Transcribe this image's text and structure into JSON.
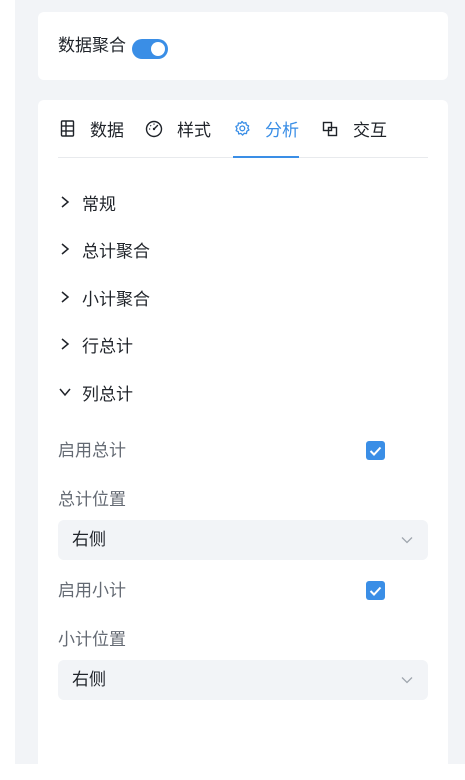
{
  "aggregation": {
    "label": "数据聚合",
    "enabled": true
  },
  "tabs": [
    {
      "label": "数据",
      "icon": "data-table-icon",
      "active": false
    },
    {
      "label": "样式",
      "icon": "style-gauge-icon",
      "active": false
    },
    {
      "label": "分析",
      "icon": "settings-gear-icon",
      "active": true
    },
    {
      "label": "交互",
      "icon": "interaction-icon",
      "active": false
    }
  ],
  "sections": [
    {
      "label": "常规",
      "expanded": false
    },
    {
      "label": "总计聚合",
      "expanded": false
    },
    {
      "label": "小计聚合",
      "expanded": false
    },
    {
      "label": "行总计",
      "expanded": false
    },
    {
      "label": "列总计",
      "expanded": true
    }
  ],
  "column_total": {
    "enable_total_label": "启用总计",
    "enable_total_checked": true,
    "total_position_label": "总计位置",
    "total_position_value": "右侧",
    "enable_subtotal_label": "启用小计",
    "enable_subtotal_checked": true,
    "subtotal_position_label": "小计位置",
    "subtotal_position_value": "右侧"
  },
  "colors": {
    "accent": "#3a8ee6",
    "panel_bg": "#f2f4f7",
    "text": "#1f2329",
    "muted_text": "#646a73"
  }
}
